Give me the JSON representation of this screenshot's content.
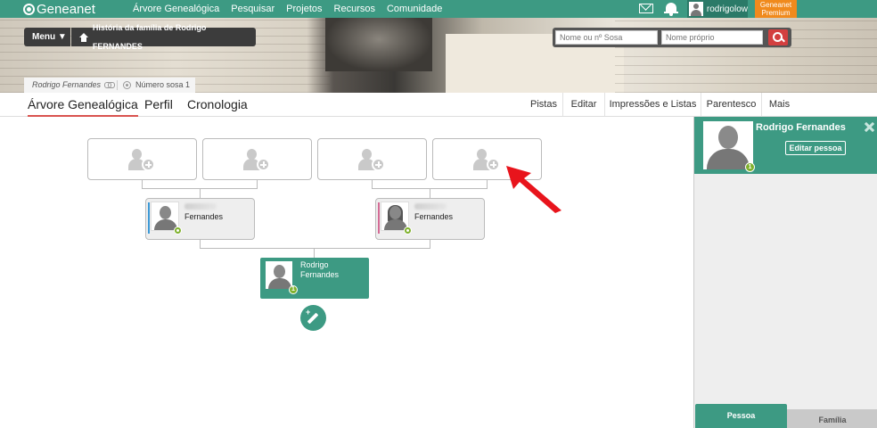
{
  "brand": {
    "logo_text": "Geneanet"
  },
  "nav": {
    "items": [
      "Árvore Genealógica",
      "Pesquisar",
      "Projetos",
      "Recursos",
      "Comunidade"
    ]
  },
  "user": {
    "username": "rodrigolow",
    "premium_label_1": "Geneanet",
    "premium_label_2": "Premium"
  },
  "banner": {
    "menu_label": "Menu ▼",
    "family_label": "História da família de Rodrigo FERNANDES",
    "search": {
      "sosa_placeholder": "Nome ou nº Sosa",
      "first_name_placeholder": "Nome próprio"
    },
    "breadcrumb": {
      "person": "Rodrigo Fernandes",
      "sosa": "Número sosa 1"
    }
  },
  "tabs": [
    {
      "label": "Árvore Genealógica",
      "active": true
    },
    {
      "label": "Perfil",
      "active": false
    },
    {
      "label": "Cronologia",
      "active": false
    }
  ],
  "actions": [
    "Pistas",
    "Editar",
    "Impressões e Listas",
    "Parentesco",
    "Mais"
  ],
  "tree": {
    "father": {
      "surname": "Fernandes"
    },
    "mother": {
      "surname": "Fernandes"
    },
    "self": {
      "name_line_1": "Rodrigo",
      "name_line_2": "Fernandes",
      "sosa_badge": "1"
    }
  },
  "panel": {
    "name": "Rodrigo Fernandes",
    "edit_button": "Editar pessoa",
    "sosa_badge": "1",
    "tab_person": "Pessoa",
    "tab_family": "Família"
  },
  "colors": {
    "brand_green": "#3d9a83",
    "premium_orange": "#f08a1d",
    "accent_red": "#d9534f",
    "arrow_red": "#e8141c"
  }
}
